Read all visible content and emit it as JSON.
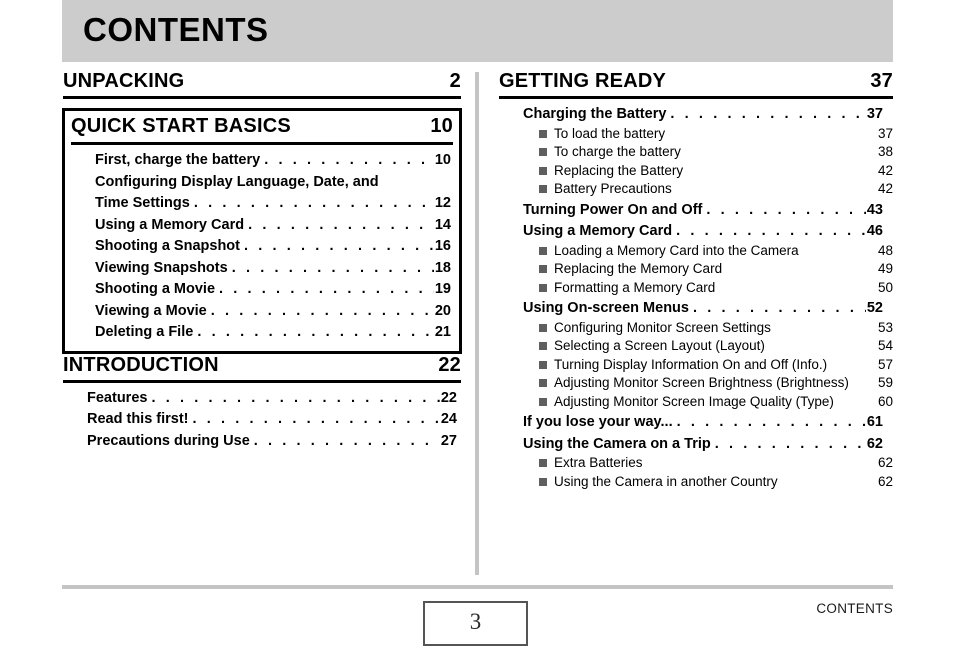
{
  "header": {
    "title": "CONTENTS",
    "background_color": "#cccccc"
  },
  "footer": {
    "page_number": "3",
    "label": "CONTENTS"
  },
  "leader_dots": ". . . . . . . . . . . . . . . . . . . . . . . . . . . . . . . . . . . . . . . . . . . . . . . . . . . . . . . . . . . . . . . . . . . . . . .",
  "bullet_color": "#5f5f5f",
  "left_column": {
    "sections": [
      {
        "name": "UNPACKING",
        "page": "2",
        "boxed": false,
        "entries": []
      },
      {
        "name": "QUICK START BASICS",
        "page": "10",
        "boxed": true,
        "entries": [
          {
            "label": "First, charge the battery",
            "page": "10"
          },
          {
            "label": "Configuring Display Language, Date, and",
            "page": "",
            "wrap_first": true
          },
          {
            "label": "Time Settings",
            "page": "12"
          },
          {
            "label": "Using a Memory Card",
            "page": "14"
          },
          {
            "label": "Shooting a Snapshot",
            "page": "16"
          },
          {
            "label": "Viewing Snapshots",
            "page": "18"
          },
          {
            "label": "Shooting a Movie",
            "page": "19"
          },
          {
            "label": "Viewing a Movie",
            "page": "20"
          },
          {
            "label": "Deleting a File",
            "page": "21"
          }
        ]
      },
      {
        "name": "INTRODUCTION",
        "page": "22",
        "boxed": false,
        "entries": [
          {
            "label": "Features",
            "page": "22"
          },
          {
            "label": "Read this first!",
            "page": "24"
          },
          {
            "label": "Precautions during Use",
            "page": "27"
          }
        ]
      }
    ]
  },
  "right_column": {
    "sections": [
      {
        "name": "GETTING READY",
        "page": "37",
        "boxed": false,
        "entries": [
          {
            "label": "Charging the Battery",
            "page": "37",
            "subentries": [
              {
                "label": "To load the battery",
                "page": "37"
              },
              {
                "label": "To charge the battery",
                "page": "38"
              },
              {
                "label": "Replacing the Battery",
                "page": "42"
              },
              {
                "label": "Battery Precautions",
                "page": "42"
              }
            ]
          },
          {
            "label": "Turning Power On and Off",
            "page": "43",
            "subentries": []
          },
          {
            "label": "Using a Memory Card",
            "page": "46",
            "subentries": [
              {
                "label": "Loading a Memory Card into the Camera",
                "page": "48"
              },
              {
                "label": "Replacing the Memory Card",
                "page": "49"
              },
              {
                "label": "Formatting a Memory Card",
                "page": "50"
              }
            ]
          },
          {
            "label": "Using On-screen Menus",
            "page": "52",
            "subentries": [
              {
                "label": "Configuring Monitor Screen Settings",
                "page": "53"
              },
              {
                "label": "Selecting a Screen Layout (Layout)",
                "page": "54"
              },
              {
                "label": "Turning Display Information On and Off (Info.)",
                "page": "57"
              },
              {
                "label": "Adjusting Monitor Screen Brightness (Brightness)",
                "page": "59"
              },
              {
                "label": "Adjusting Monitor Screen Image Quality (Type)",
                "page": "60"
              }
            ]
          },
          {
            "label": "If you lose your way...",
            "page": "61",
            "subentries": []
          },
          {
            "label": "Using the Camera on a Trip",
            "page": "62",
            "subentries": [
              {
                "label": "Extra Batteries",
                "page": "62"
              },
              {
                "label": "Using the Camera in another Country",
                "page": "62"
              }
            ]
          }
        ]
      }
    ]
  }
}
